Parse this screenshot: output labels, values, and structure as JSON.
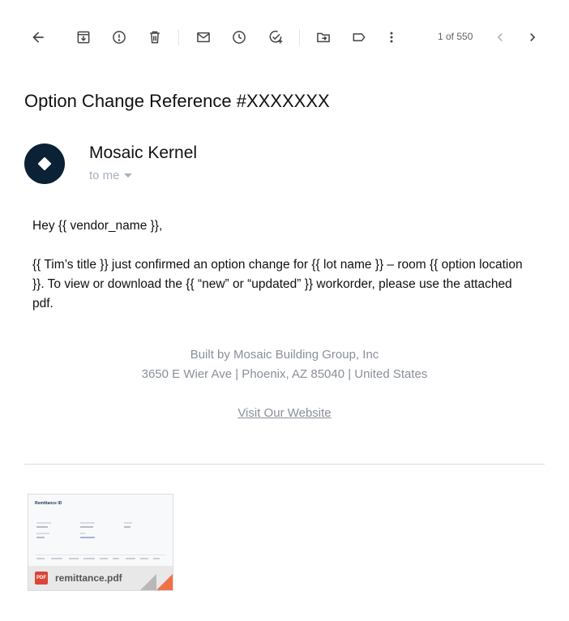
{
  "toolbar": {
    "pager_text": "1 of 550"
  },
  "email": {
    "subject": "Option Change Reference #XXXXXXX",
    "sender_name": "Mosaic Kernel",
    "recipient": "to me",
    "greeting": "Hey {{ vendor_name }},",
    "body": "{{ Tim’s title }} just confirmed an option change for {{ lot name }} – room {{ option location }}. To view or download the {{ “new” or “updated” }} workorder, please use the attached pdf.",
    "footer_line1": "Built by Mosaic Building Group, Inc",
    "footer_line2": "3650 E Wier Ave | Phoenix, AZ 85040 | United States",
    "footer_link": "Visit Our Website"
  },
  "attachment": {
    "filename": "remittance.pdf",
    "badge": "PDF",
    "preview_title": "Remittance ID"
  },
  "colors": {
    "avatar_bg": "#0b2136",
    "pdf_red": "#db4437",
    "fold_orange": "#f07148",
    "footer_gray": "#8a8f99"
  }
}
